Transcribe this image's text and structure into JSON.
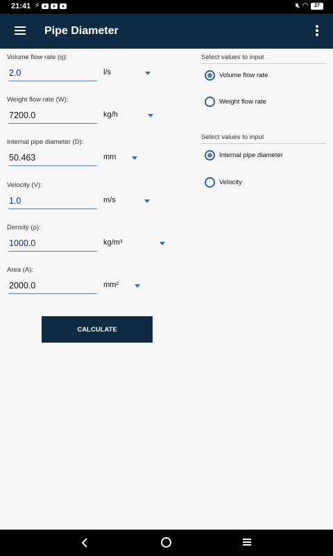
{
  "status_bar": {
    "time": "21:41",
    "battery": "27"
  },
  "app_bar": {
    "title": "Pipe Diameter"
  },
  "fields": [
    {
      "label": "Volume flow rate (q):",
      "value": "2.0",
      "unit": "l/s"
    },
    {
      "label": "Weight flow rate (W):",
      "value": "7200.0",
      "unit": "kg/h"
    },
    {
      "label": "Internal pipe diameter (D):",
      "value": "50.463",
      "unit": "mm"
    },
    {
      "label": "Velocity (V):",
      "value": "1.0",
      "unit": "m/s"
    },
    {
      "label": "Density (ρ):",
      "value": "1000.0",
      "unit": "kg/m³"
    },
    {
      "label": "Area (A):",
      "value": "2000.0",
      "unit": "mm²"
    }
  ],
  "groups": [
    {
      "header": "Select values to input",
      "options": [
        {
          "label": "Volume flow rate",
          "selected": true
        },
        {
          "label": "Weight flow rate",
          "selected": false
        }
      ]
    },
    {
      "header": "Select values to input",
      "options": [
        {
          "label": "Internal pipe diameter",
          "selected": true
        },
        {
          "label": "Velocity",
          "selected": false
        }
      ]
    }
  ],
  "calculate_label": "CALCULATE",
  "colors": {
    "app_bar": "#0f2a43",
    "accent": "#2d6ea6"
  }
}
